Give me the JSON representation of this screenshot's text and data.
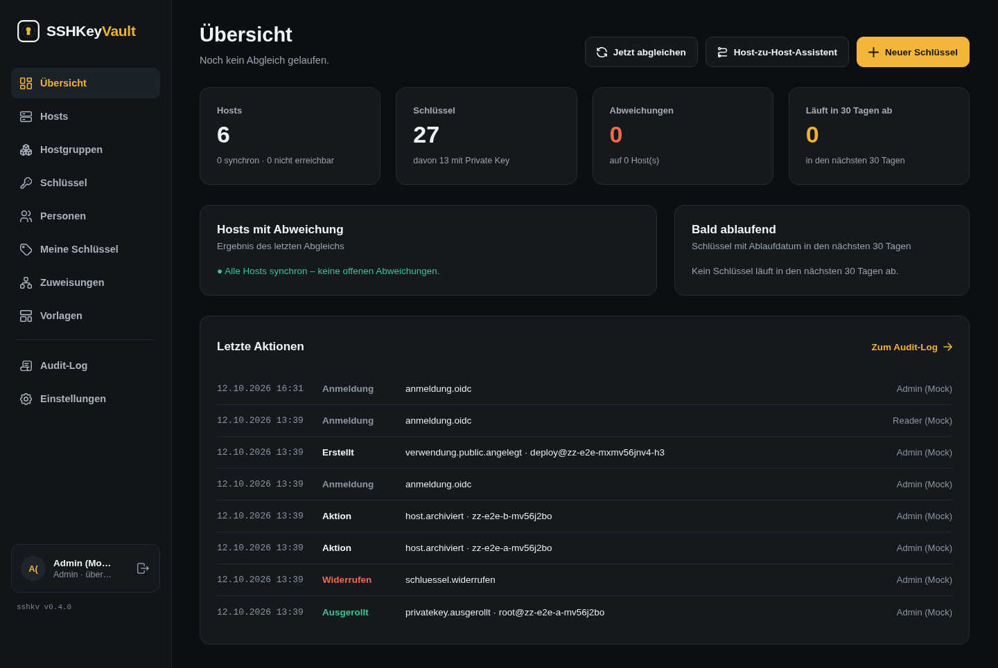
{
  "sidebar": {
    "brand": {
      "name": "SSHKey",
      "name_accent": "Vault"
    },
    "nav": [
      {
        "label": "Übersicht",
        "selected": true
      },
      {
        "label": "Hosts",
        "selected": false
      },
      {
        "label": "Hostgruppen",
        "selected": false
      },
      {
        "label": "Schlüssel",
        "selected": false
      },
      {
        "label": "Personen",
        "selected": false
      },
      {
        "label": "Meine Schlüssel",
        "selected": false
      },
      {
        "label": "Zuweisungen",
        "selected": false
      },
      {
        "label": "Vorlagen",
        "selected": false
      }
    ],
    "nav_secondary": [
      {
        "label": "Audit-Log",
        "selected": false
      },
      {
        "label": "Einstellungen",
        "selected": false
      }
    ],
    "user": {
      "initials": "A(",
      "name": "Admin (Mo…",
      "role": "Admin · über…"
    },
    "version": "sshkv v0.4.0"
  },
  "header": {
    "title": "Übersicht",
    "subtitle": "Noch kein Abgleich gelaufen.",
    "buttons": [
      {
        "label": "Jetzt abgleichen",
        "kind": "secondary"
      },
      {
        "label": "Host-zu-Host-Assistent",
        "kind": "secondary"
      },
      {
        "label": "Neuer Schlüssel",
        "kind": "primary"
      }
    ]
  },
  "stats": [
    {
      "label": "Hosts",
      "value": "6",
      "color": "#eef1f4",
      "note": "0 synchron · 0 nicht erreichbar"
    },
    {
      "label": "Schlüssel",
      "value": "27",
      "color": "#eef1f4",
      "note": "davon 13 mit Private Key"
    },
    {
      "label": "Abweichungen",
      "value": "0",
      "color": "#f0694a",
      "note": "auf 0 Host(s)"
    },
    {
      "label": "Läuft in 30 Tagen ab",
      "value": "0",
      "color": "#f0b232",
      "note": "in den nächsten 30 Tagen"
    }
  ],
  "panels": [
    {
      "title": "Hosts mit Abweichung",
      "subtitle": "Ergebnis des letzten Abgleichs",
      "message": "● Alle Hosts synchron – keine offenen Abweichungen.",
      "color": "#3cc48f"
    },
    {
      "title": "Bald ablaufend",
      "subtitle": "Schlüssel mit Ablaufdatum in den nächsten 30 Tagen",
      "message": "Kein Schlüssel läuft in den nächsten 30 Tagen ab.",
      "color": "#9aa3ad"
    }
  ],
  "activity": {
    "title": "Letzte Aktionen",
    "link": "Zum Audit-Log",
    "rows": [
      {
        "time": "12.10.2026 16:31",
        "action": "Anmeldung",
        "color": "#8b95a1",
        "detail": "anmeldung.oidc",
        "actor": "Admin (Mock)"
      },
      {
        "time": "12.10.2026 13:39",
        "action": "Anmeldung",
        "color": "#8b95a1",
        "detail": "anmeldung.oidc",
        "actor": "Reader (Mock)"
      },
      {
        "time": "12.10.2026 13:39",
        "action": "Erstellt",
        "color": "#f1f3f5",
        "detail": "verwendung.public.angelegt · deploy@zz-e2e-mxmv56jnv4-h3",
        "actor": "Admin (Mock)"
      },
      {
        "time": "12.10.2026 13:39",
        "action": "Anmeldung",
        "color": "#8b95a1",
        "detail": "anmeldung.oidc",
        "actor": "Admin (Mock)"
      },
      {
        "time": "12.10.2026 13:39",
        "action": "Aktion",
        "color": "#f1f3f5",
        "detail": "host.archiviert · zz-e2e-b-mv56j2bo",
        "actor": "Admin (Mock)"
      },
      {
        "time": "12.10.2026 13:39",
        "action": "Aktion",
        "color": "#f1f3f5",
        "detail": "host.archiviert · zz-e2e-a-mv56j2bo",
        "actor": "Admin (Mock)"
      },
      {
        "time": "12.10.2026 13:39",
        "action": "Widerrufen",
        "color": "#f0694a",
        "detail": "schluessel.widerrufen",
        "actor": "Admin (Mock)"
      },
      {
        "time": "12.10.2026 13:39",
        "action": "Ausgerollt",
        "color": "#3cc48f",
        "detail": "privatekey.ausgerollt · root@zz-e2e-a-mv56j2bo",
        "actor": "Admin (Mock)"
      }
    ]
  }
}
